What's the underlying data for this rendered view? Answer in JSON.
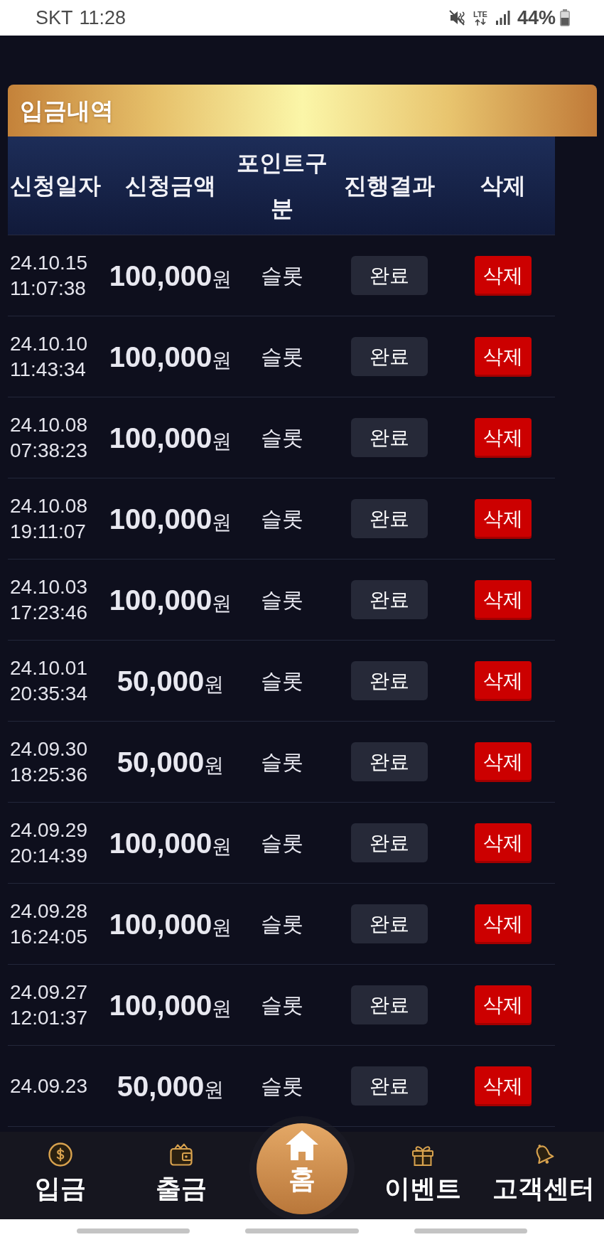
{
  "status_bar": {
    "carrier": "SKT",
    "time": "11:28",
    "network": "LTE",
    "battery": "44%"
  },
  "panel": {
    "title": "입금내역"
  },
  "table": {
    "columns": [
      "신청일자",
      "신청금액",
      "포인트구분",
      "진행결과",
      "삭제"
    ],
    "rows": [
      {
        "date": "24.10.15",
        "time": "11:07:38",
        "amount": "100,000",
        "unit": "원",
        "point_type": "슬롯",
        "status": "완료",
        "action": "삭제"
      },
      {
        "date": "24.10.10",
        "time": "11:43:34",
        "amount": "100,000",
        "unit": "원",
        "point_type": "슬롯",
        "status": "완료",
        "action": "삭제"
      },
      {
        "date": "24.10.08",
        "time": "07:38:23",
        "amount": "100,000",
        "unit": "원",
        "point_type": "슬롯",
        "status": "완료",
        "action": "삭제"
      },
      {
        "date": "24.10.08",
        "time": "19:11:07",
        "amount": "100,000",
        "unit": "원",
        "point_type": "슬롯",
        "status": "완료",
        "action": "삭제"
      },
      {
        "date": "24.10.03",
        "time": "17:23:46",
        "amount": "100,000",
        "unit": "원",
        "point_type": "슬롯",
        "status": "완료",
        "action": "삭제"
      },
      {
        "date": "24.10.01",
        "time": "20:35:34",
        "amount": "50,000",
        "unit": "원",
        "point_type": "슬롯",
        "status": "완료",
        "action": "삭제"
      },
      {
        "date": "24.09.30",
        "time": "18:25:36",
        "amount": "50,000",
        "unit": "원",
        "point_type": "슬롯",
        "status": "완료",
        "action": "삭제"
      },
      {
        "date": "24.09.29",
        "time": "20:14:39",
        "amount": "100,000",
        "unit": "원",
        "point_type": "슬롯",
        "status": "완료",
        "action": "삭제"
      },
      {
        "date": "24.09.28",
        "time": "16:24:05",
        "amount": "100,000",
        "unit": "원",
        "point_type": "슬롯",
        "status": "완료",
        "action": "삭제"
      },
      {
        "date": "24.09.27",
        "time": "12:01:37",
        "amount": "100,000",
        "unit": "원",
        "point_type": "슬롯",
        "status": "완료",
        "action": "삭제"
      },
      {
        "date": "24.09.23",
        "amount": "50,000",
        "unit": "원",
        "point_type": "슬롯",
        "status": "완료",
        "action": "삭제"
      }
    ]
  },
  "bottom_nav": [
    {
      "label": "입금",
      "kind": "item"
    },
    {
      "label": "출금",
      "kind": "item"
    },
    {
      "label": "홈",
      "kind": "center"
    },
    {
      "label": "이벤트",
      "kind": "item"
    },
    {
      "label": "고객센터",
      "kind": "item"
    }
  ]
}
